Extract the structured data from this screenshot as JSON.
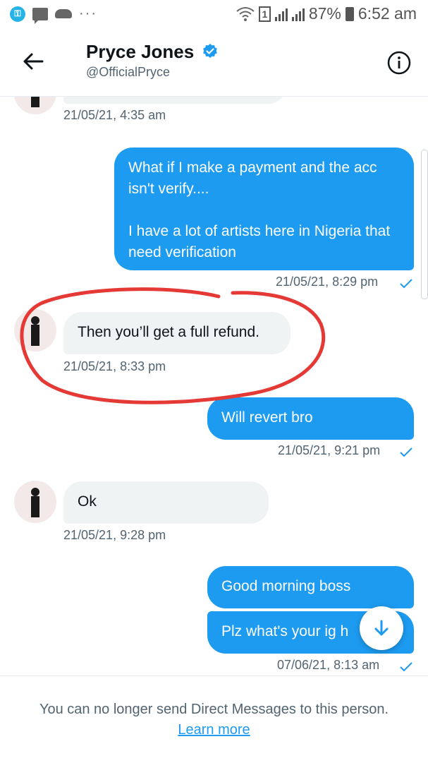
{
  "status_bar": {
    "more_indicator": "···",
    "sim_slot": "1",
    "battery": "87%",
    "time": "6:52 am"
  },
  "header": {
    "name": "Pryce Jones",
    "handle": "@OfficialPryce"
  },
  "messages": [
    {
      "direction": "in",
      "text": "",
      "timestamp": "21/05/21, 4:35 am"
    },
    {
      "direction": "out",
      "text": "What if I make a payment and the acc isn't verify....\n\nI have a lot of artists  here in Nigeria that need verification",
      "timestamp": "21/05/21, 8:29 pm"
    },
    {
      "direction": "in",
      "text": "Then you’ll get a full refund.",
      "timestamp": "21/05/21, 8:33 pm"
    },
    {
      "direction": "out",
      "text": "Will revert  bro",
      "timestamp": "21/05/21, 9:21 pm"
    },
    {
      "direction": "in",
      "text": "Ok",
      "timestamp": "21/05/21, 9:28 pm"
    },
    {
      "direction": "out",
      "text": "Good morning boss",
      "timestamp": ""
    },
    {
      "direction": "out",
      "text": "Plz what's your ig h",
      "timestamp": "07/06/21, 8:13 am"
    }
  ],
  "footer": {
    "notice": "You can no longer send Direct Messages to this person.",
    "link": "Learn more"
  },
  "colors": {
    "accent": "#1d9bf0",
    "incoming_bubble": "#eff3f4",
    "annotation": "#e53935"
  }
}
